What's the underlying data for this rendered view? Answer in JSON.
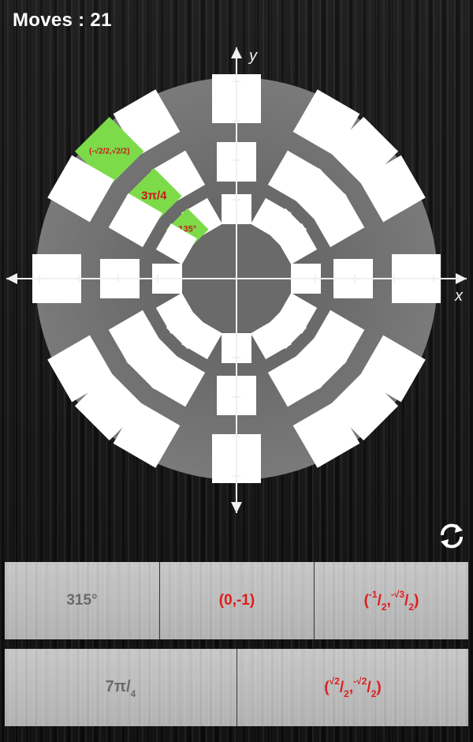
{
  "header": {
    "moves_label": "Moves : 21"
  },
  "axes": {
    "x_label": "x",
    "y_label": "y"
  },
  "placed_tiles": [
    {
      "ring": "outer",
      "angle_deg": 135,
      "text": "(-√2/2,√2/2)",
      "color": "#7ddb4a"
    },
    {
      "ring": "middle",
      "angle_deg": 135,
      "text": "3π/4",
      "color": "#7ddb4a"
    },
    {
      "ring": "inner",
      "angle_deg": 135,
      "text": "135°",
      "color": "#7ddb4a"
    }
  ],
  "answer_rows": [
    [
      {
        "text": "315°",
        "color": "gray"
      },
      {
        "text": "(0,-1)",
        "color": "red"
      },
      {
        "text": "(-1/2,-√3/2)",
        "color": "red"
      }
    ],
    [
      {
        "text": "7π/4",
        "color": "gray"
      },
      {
        "text": "(√2/2,-√2/2)",
        "color": "red"
      }
    ]
  ],
  "icons": {
    "refresh": "refresh-icon"
  },
  "colors": {
    "tile_empty": "#ffffff",
    "tile_filled": "#7ddb4a",
    "tile_text": "#c81a1a",
    "card_red": "#e01b1b",
    "card_gray": "#6a6a6a"
  }
}
